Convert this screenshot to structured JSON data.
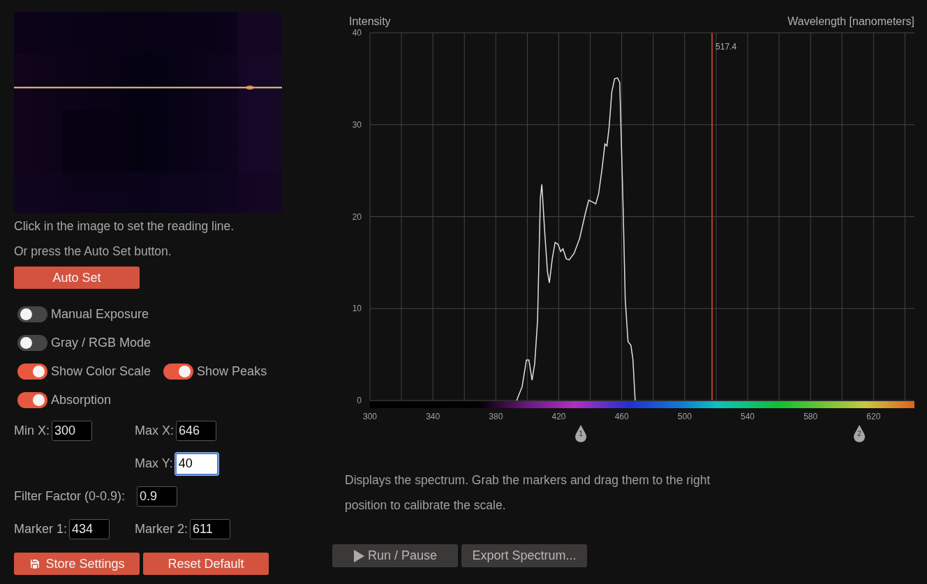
{
  "camera": {
    "kind": "picture"
  },
  "hints": [
    "Click in the image to set the reading line.",
    "Or press the Auto Set button."
  ],
  "auto_set_button": "Auto Set",
  "toggle_rows": [
    [
      {
        "label": "Manual Exposure",
        "on": false
      }
    ],
    [
      {
        "label": "Gray / RGB Mode",
        "on": false
      }
    ],
    [
      {
        "label": "Show Color Scale",
        "on": true
      },
      {
        "label": "Show Peaks",
        "on": true
      }
    ],
    [
      {
        "label": "Absorption",
        "on": true
      }
    ]
  ],
  "field_rows": [
    [
      {
        "kind": "pair",
        "label": "Min X:",
        "value": "300",
        "focused": false
      },
      {
        "kind": "pair",
        "label": "Max X:",
        "value": "646",
        "focused": false
      }
    ],
    [
      {
        "kind": "spacer"
      },
      {
        "kind": "pair",
        "label": "Max Y:",
        "value": "40",
        "focused": true
      }
    ],
    [
      {
        "kind": "wide",
        "label": "Filter Factor (0-0.9):",
        "value": "0.9",
        "focused": false
      }
    ],
    [
      {
        "kind": "pair",
        "label": "Marker 1:",
        "value": "434",
        "focused": false
      },
      {
        "kind": "pair",
        "label": "Marker 2:",
        "value": "611",
        "focused": false
      }
    ]
  ],
  "settings_buttons": [
    {
      "kind": "save",
      "label": "Store Settings"
    },
    {
      "kind": "plain",
      "label": "Reset Default"
    }
  ],
  "chart": {
    "chart_data": {
      "type": "line",
      "ylabel": "Intensity",
      "xlabel": "Wavelength [nanometers]",
      "xlim": [
        300,
        646
      ],
      "ylim": [
        0,
        40
      ],
      "xticks": [
        300,
        340,
        380,
        420,
        460,
        500,
        540,
        580,
        620
      ],
      "yticks": [
        0,
        10,
        20,
        30,
        40
      ],
      "x": [
        393.2,
        396.7,
        399.4,
        401,
        403,
        404.7,
        406.5,
        408.3,
        409.2,
        411,
        412.8,
        414,
        415.9,
        417.7,
        419.5,
        421.2,
        422.6,
        424.8,
        426.6,
        429.7,
        433.2,
        436.8,
        439,
        441.3,
        443.5,
        445.3,
        447.5,
        449.3,
        450.6,
        452,
        453.7,
        455.5,
        457.3,
        458.7,
        460.9,
        462.2,
        464,
        465.8,
        467.1,
        468.5
      ],
      "grid": true,
      "series": [
        {
          "color": "#e0e0e0",
          "values": [
            0,
            1.5,
            4.4,
            4.4,
            2.2,
            4,
            8.7,
            22,
            23.5,
            18.5,
            14,
            12.8,
            15.5,
            17.2,
            17,
            16.2,
            16.5,
            15.4,
            15.3,
            16,
            17.6,
            20.3,
            21.8,
            21.6,
            21.4,
            22.5,
            25.2,
            27.9,
            27.7,
            29.8,
            33.6,
            35,
            35.1,
            34.6,
            20.9,
            11,
            6.4,
            6,
            4.5,
            0
          ]
        }
      ],
      "ref_lines": [
        {
          "axis": "x",
          "value": 517.4,
          "label": "517.4",
          "color": "#b5412f"
        }
      ]
    },
    "markers": [
      {
        "label": "1"
      },
      {
        "label": "2"
      }
    ]
  },
  "description": "Displays the spectrum. Grab the markers and drag them to the right position to calibrate the scale.",
  "action_buttons": [
    {
      "kind": "play",
      "label": "Run / Pause"
    },
    {
      "kind": "plain",
      "label": "Export Spectrum..."
    }
  ]
}
